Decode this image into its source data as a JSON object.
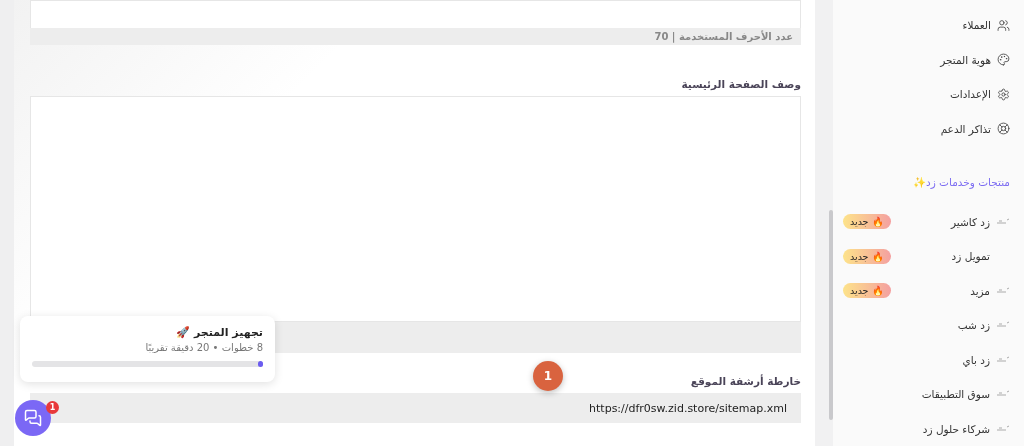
{
  "form": {
    "title_counter": "عدد الأحرف المستخدمة | 70",
    "description_label": "وصف الصفحة الرئيسية",
    "sitemap_label": "خارطة أرشفة الموقع",
    "sitemap_value": "https://dfr0sw.zid.store/sitemap.xml",
    "step_marker": "1"
  },
  "setup_card": {
    "title": "تجهيز المتجر 🚀",
    "subtitle": "8 خطوات • 20 دقيقة تقريبًا",
    "level": 0.02
  },
  "chat": {
    "badge": "1"
  },
  "sidebar": {
    "items": [
      {
        "label": "العملاء",
        "kind": "users"
      },
      {
        "label": "هوية المتجر",
        "kind": "palette"
      },
      {
        "label": "الإعدادات",
        "kind": "gear"
      },
      {
        "label": "تذاكر الدعم",
        "kind": "lifebuoy"
      }
    ],
    "section_title": "منتجات وخدمات زد✨",
    "products": [
      {
        "label": "زد كاشير",
        "kind": "logo",
        "badge": "🔥 جديد"
      },
      {
        "label": "تمويل زد",
        "kind": "plain",
        "badge": "🔥 جديد"
      },
      {
        "label": "مزيد",
        "kind": "logo",
        "badge": "🔥 جديد"
      },
      {
        "label": "زد شب",
        "kind": "logo"
      },
      {
        "label": "زد باي",
        "kind": "logo"
      },
      {
        "label": "سوق التطبيقات",
        "kind": "logo"
      },
      {
        "label": "شركاء حلول زد",
        "kind": "logo"
      }
    ]
  }
}
